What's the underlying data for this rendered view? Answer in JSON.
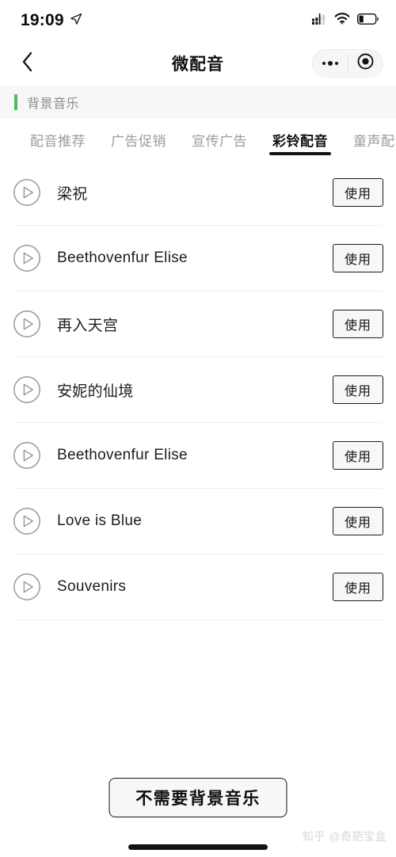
{
  "status_bar": {
    "time": "19:09",
    "location_icon": "location-arrow-icon",
    "signal_icon": "cellular-signal-icon",
    "wifi_icon": "wifi-icon",
    "battery_icon": "battery-low-icon"
  },
  "nav": {
    "back_icon": "chevron-left-icon",
    "title": "微配音",
    "more_icon": "more-dots-icon",
    "target_icon": "target-circle-icon"
  },
  "section": {
    "title": "背景音乐",
    "accent_color": "#4cbb5b"
  },
  "tabs": [
    {
      "label": "配音推荐",
      "active": false
    },
    {
      "label": "广告促销",
      "active": false
    },
    {
      "label": "宣传广告",
      "active": false
    },
    {
      "label": "彩铃配音",
      "active": true
    },
    {
      "label": "童声配音",
      "active": false
    }
  ],
  "list": {
    "play_icon": "play-circle-icon",
    "use_label": "使用",
    "items": [
      {
        "name": "梁祝"
      },
      {
        "name": "Beethovenfur Elise"
      },
      {
        "name": "再入天宫"
      },
      {
        "name": "安妮的仙境"
      },
      {
        "name": "Beethovenfur Elise"
      },
      {
        "name": "Love is Blue"
      },
      {
        "name": "Souvenirs"
      }
    ]
  },
  "bottom": {
    "no_bgm_label": "不需要背景音乐",
    "watermark": "知乎 @奇葩宝盒"
  }
}
